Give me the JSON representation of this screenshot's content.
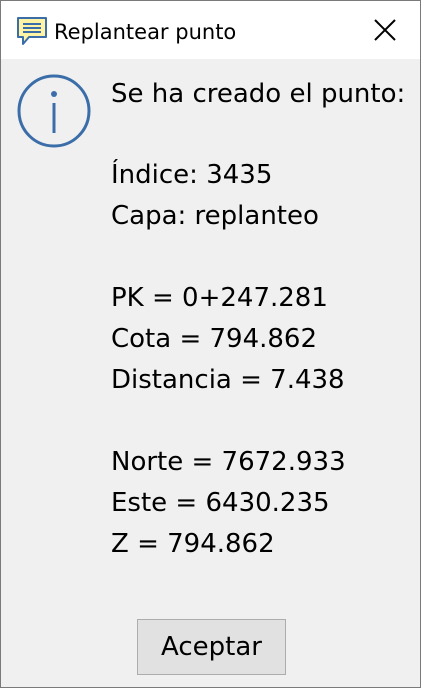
{
  "window": {
    "title": "Replantear punto"
  },
  "message": {
    "heading": "Se ha creado el punto:",
    "indice": "Índice: 3435",
    "capa": "Capa: replanteo",
    "pk": "PK = 0+247.281",
    "cota": "Cota = 794.862",
    "distancia": "Distancia = 7.438",
    "norte": "Norte = 7672.933",
    "este": "Este = 6430.235",
    "z": "Z = 794.862"
  },
  "buttons": {
    "ok_label": "Aceptar"
  },
  "icons": {
    "app": "message-icon",
    "info": "info-icon",
    "close": "close-icon"
  },
  "colors": {
    "info_accent": "#3b6ea8",
    "app_icon_fill": "#fff4a3"
  }
}
